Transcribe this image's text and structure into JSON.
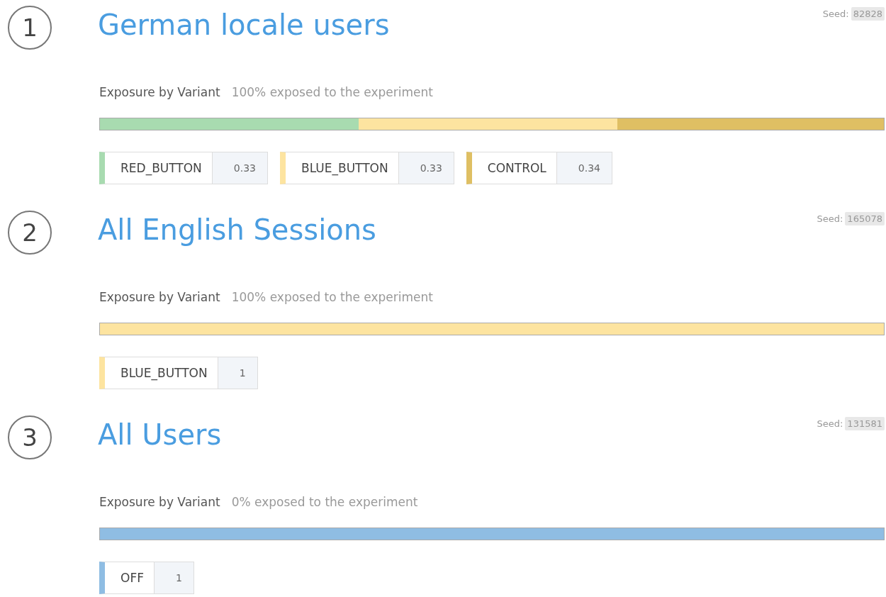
{
  "segments": [
    {
      "number": "1",
      "title": "German locale users",
      "seed_label": "Seed:",
      "seed": "82828",
      "exposure_label": "Exposure by Variant",
      "exposure_text": "100% exposed to the experiment",
      "variants": [
        {
          "name": "RED_BUTTON",
          "share": "0.33",
          "color": "#a8dbb0"
        },
        {
          "name": "BLUE_BUTTON",
          "share": "0.33",
          "color": "#fde4a0"
        },
        {
          "name": "CONTROL",
          "share": "0.34",
          "color": "#dfbf63"
        }
      ]
    },
    {
      "number": "2",
      "title": "All English Sessions",
      "seed_label": "Seed:",
      "seed": "165078",
      "exposure_label": "Exposure by Variant",
      "exposure_text": "100% exposed to the experiment",
      "variants": [
        {
          "name": "BLUE_BUTTON",
          "share": "1",
          "color": "#fde4a0"
        }
      ]
    },
    {
      "number": "3",
      "title": "All Users",
      "seed_label": "Seed:",
      "seed": "131581",
      "exposure_label": "Exposure by Variant",
      "exposure_text": "0% exposed to the experiment",
      "variants": [
        {
          "name": "OFF",
          "share": "1",
          "color": "#8fbde3"
        }
      ]
    }
  ]
}
